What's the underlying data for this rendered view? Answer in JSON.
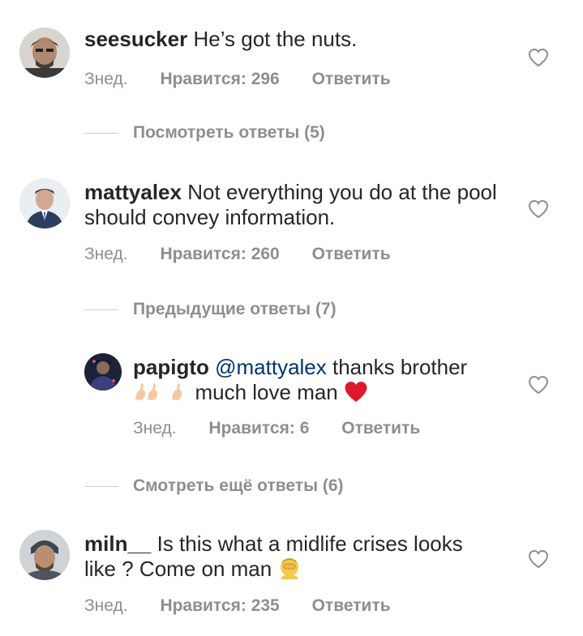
{
  "comments": [
    {
      "user": "seesucker",
      "text": "He’s got the nuts.",
      "time": "Знед.",
      "likes": "Нравится: 296",
      "reply": "Ответить"
    },
    {
      "user": "mattyalex",
      "text": "Not everything you do at the pool should convey information.",
      "time": "Знед.",
      "likes": "Нравится: 260",
      "reply": "Ответить"
    },
    {
      "user": "papigto",
      "mention": "@mattyalex",
      "text": "thanks brother",
      "text2": "much love man",
      "time": "Знед.",
      "likes": "Нравится: 6",
      "reply": "Ответить"
    },
    {
      "user": "miln__",
      "text": "Is this what a midlife crises looks like ? Come on man",
      "time": "Знед.",
      "likes": "Нравится: 235",
      "reply": "Ответить"
    }
  ],
  "threads": {
    "view_replies": "Посмотреть ответы (5)",
    "previous_replies": "Предыдущие ответы (7)",
    "more_replies": "Смотреть ещё ответы (6)"
  },
  "icons": {
    "like": "heart-outline-icon",
    "flex": "flexed-biceps-emoji",
    "love": "red-heart-emoji",
    "facepalm": "person-facepalming-emoji"
  },
  "colors": {
    "text": "#262626",
    "muted": "#8e8e8e",
    "mention": "#003569",
    "emoji_heart": "#e0182d"
  }
}
